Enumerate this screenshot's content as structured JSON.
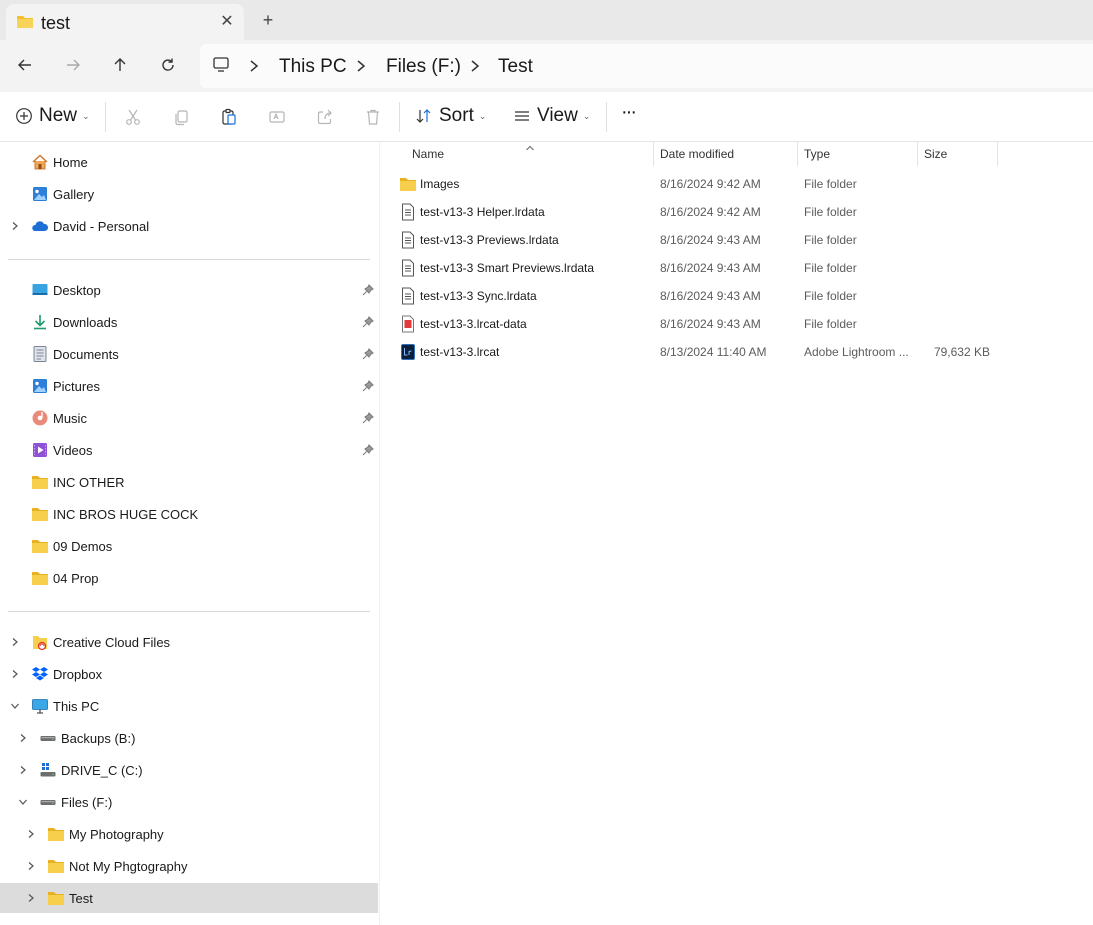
{
  "tab": {
    "title": "test",
    "close_glyph": "✕",
    "new_tab_glyph": "+"
  },
  "nav": {
    "back_icon": "arrow-left-icon",
    "forward_icon": "arrow-right-icon",
    "up_icon": "arrow-up-icon",
    "refresh_icon": "refresh-icon"
  },
  "breadcrumb": [
    "This PC",
    "Files (F:)",
    "Test"
  ],
  "commands": {
    "new_label": "New",
    "sort_label": "Sort",
    "view_label": "View",
    "more_glyph": "···"
  },
  "sidebar": {
    "top": [
      {
        "label": "Home",
        "icon": "home-icon"
      },
      {
        "label": "Gallery",
        "icon": "gallery-icon"
      },
      {
        "label": "David - Personal",
        "icon": "onedrive-icon"
      }
    ],
    "quick_access": [
      {
        "label": "Desktop",
        "icon": "desktop-icon",
        "pinned": true
      },
      {
        "label": "Downloads",
        "icon": "downloads-icon",
        "pinned": true
      },
      {
        "label": "Documents",
        "icon": "documents-icon",
        "pinned": true
      },
      {
        "label": "Pictures",
        "icon": "pictures-icon",
        "pinned": true
      },
      {
        "label": "Music",
        "icon": "music-icon",
        "pinned": true
      },
      {
        "label": "Videos",
        "icon": "videos-icon",
        "pinned": true
      },
      {
        "label": "INC OTHER",
        "icon": "folder-icon",
        "pinned": false
      },
      {
        "label": "INC BROS HUGE COCK",
        "icon": "folder-icon",
        "pinned": false
      },
      {
        "label": "09 Demos",
        "icon": "folder-icon",
        "pinned": false
      },
      {
        "label": "04 Prop",
        "icon": "folder-icon",
        "pinned": false
      }
    ],
    "tree": [
      {
        "label": "Creative Cloud Files",
        "icon": "creative-cloud-icon",
        "expanded": false
      },
      {
        "label": "Dropbox",
        "icon": "dropbox-icon",
        "expanded": false
      },
      {
        "label": "This PC",
        "icon": "pc-icon",
        "expanded": true
      },
      {
        "label": "Backups (B:)",
        "icon": "drive-icon",
        "expanded": false
      },
      {
        "label": "DRIVE_C (C:)",
        "icon": "windows-drive-icon",
        "expanded": false
      },
      {
        "label": "Files (F:)",
        "icon": "drive-icon",
        "expanded": true
      },
      {
        "label": "My Photography",
        "icon": "folder-icon",
        "expanded": false
      },
      {
        "label": "Not My Phgtography",
        "icon": "folder-icon",
        "expanded": false
      },
      {
        "label": "Test",
        "icon": "folder-icon",
        "expanded": false,
        "selected": true
      }
    ]
  },
  "columns": {
    "name": "Name",
    "date": "Date modified",
    "type": "Type",
    "size": "Size"
  },
  "files": [
    {
      "name": "Images",
      "date": "8/16/2024 9:42 AM",
      "type": "File folder",
      "size": "",
      "icon": "folder-icon"
    },
    {
      "name": "test-v13-3 Helper.lrdata",
      "date": "8/16/2024 9:42 AM",
      "type": "File folder",
      "size": "",
      "icon": "lrdata-file-icon"
    },
    {
      "name": "test-v13-3 Previews.lrdata",
      "date": "8/16/2024 9:43 AM",
      "type": "File folder",
      "size": "",
      "icon": "lrdata-file-icon"
    },
    {
      "name": "test-v13-3 Smart Previews.lrdata",
      "date": "8/16/2024 9:43 AM",
      "type": "File folder",
      "size": "",
      "icon": "lrdata-file-icon"
    },
    {
      "name": "test-v13-3 Sync.lrdata",
      "date": "8/16/2024 9:43 AM",
      "type": "File folder",
      "size": "",
      "icon": "lrdata-file-icon"
    },
    {
      "name": "test-v13-3.lrcat-data",
      "date": "8/16/2024 9:43 AM",
      "type": "File folder",
      "size": "",
      "icon": "lrcat-data-icon"
    },
    {
      "name": "test-v13-3.lrcat",
      "date": "8/13/2024 11:40 AM",
      "type": "Adobe Lightroom ...",
      "size": "79,632 KB",
      "icon": "lightroom-catalog-icon"
    }
  ],
  "colors": {
    "folder": "#f2c22e",
    "selected_bg": "#dcdcdc",
    "titlebar_bg": "#e9e9e9",
    "accent_blue": "#1d6fd6"
  }
}
